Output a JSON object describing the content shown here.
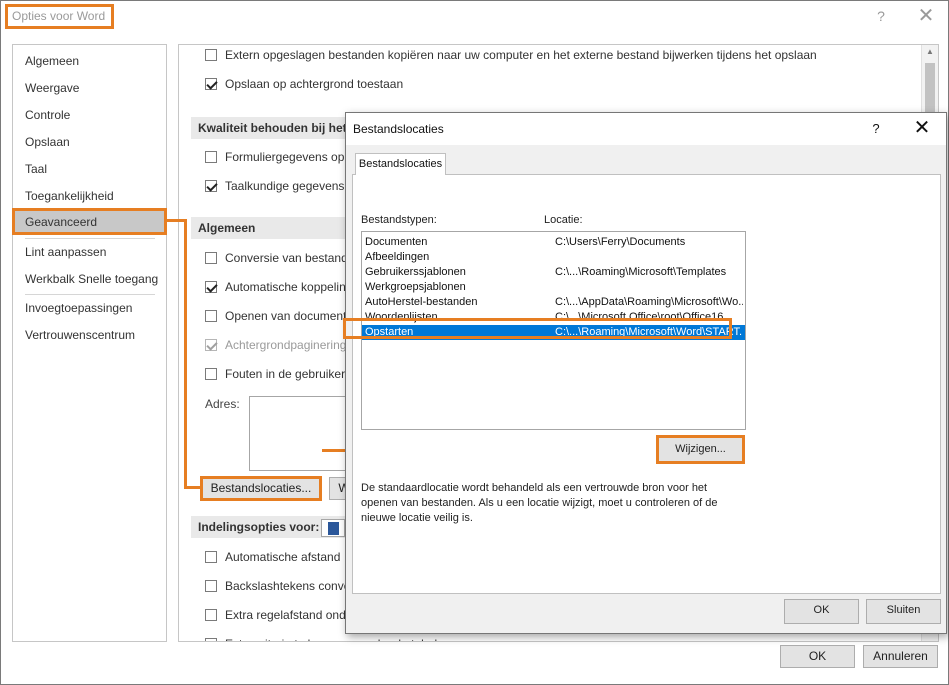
{
  "window": {
    "title": "Opties voor Word",
    "help": "?",
    "close": "✕"
  },
  "nav": {
    "items": [
      {
        "label": "Algemeen"
      },
      {
        "label": "Weergave"
      },
      {
        "label": "Controle"
      },
      {
        "label": "Opslaan"
      },
      {
        "label": "Taal"
      },
      {
        "label": "Toegankelijkheid"
      },
      {
        "label": "Geavanceerd",
        "selected": true
      },
      {
        "label": "Lint aanpassen"
      },
      {
        "label": "Werkbalk Snelle toegang"
      },
      {
        "label": "Invoegtoepassingen"
      },
      {
        "label": "Vertrouwenscentrum"
      }
    ]
  },
  "content": {
    "opt_extern": "Extern opgeslagen bestanden kopiëren naar uw computer en het externe bestand bijwerken tijdens het opslaan",
    "opt_achtergrond": "Opslaan op achtergrond toestaan",
    "section_kwaliteit": "Kwaliteit behouden bij het",
    "opt_formulier": "Formuliergegevens op",
    "opt_taalkundig": "Taalkundige gegevens",
    "section_algemeen": "Algemeen",
    "opt_conversie": "Conversie van bestand",
    "opt_koppeling": "Automatische koppelin",
    "opt_openen": "Openen van document",
    "opt_paginering": "Achtergrondpaginering",
    "opt_fouten": "Fouten in de gebruiker",
    "adres_label": "Adres:",
    "btn_bestandslocaties": "Bestandslocaties...",
    "btn_w": "W",
    "section_indeling": "Indelingsopties voor:",
    "opt_afstand": "Automatische afstand",
    "opt_backslash": "Backslashtekens conve",
    "opt_regelafstand": "Extra regelafstand ond",
    "opt_last": "Extra witruimte boven en onder de tabel"
  },
  "buttons": {
    "ok": "OK",
    "cancel": "Annuleren"
  },
  "dialog": {
    "title": "Bestandslocaties",
    "help": "?",
    "close": "✕",
    "tab": "Bestandslocaties",
    "hdr_types": "Bestandstypen:",
    "hdr_locatie": "Locatie:",
    "rows": [
      {
        "type": "Documenten",
        "path": "C:\\Users\\Ferry\\Documents"
      },
      {
        "type": "Afbeeldingen",
        "path": ""
      },
      {
        "type": "Gebruikerssjablonen",
        "path": "C:\\...\\Roaming\\Microsoft\\Templates"
      },
      {
        "type": "Werkgroepsjablonen",
        "path": ""
      },
      {
        "type": "AutoHerstel-bestanden",
        "path": "C:\\...\\AppData\\Roaming\\Microsoft\\Wo..."
      },
      {
        "type": "Woordenlijsten",
        "path": "C:\\...\\Microsoft Office\\root\\Office16"
      },
      {
        "type": "Opstarten",
        "path": "C:\\...\\Roaming\\Microsoft\\Word\\START...",
        "selected": true
      }
    ],
    "btn_wijzigen": "Wijzigen...",
    "info": "De standaardlocatie wordt behandeld als een vertrouwde bron voor het openen van bestanden. Als u een locatie wijzigt, moet u controleren of de nieuwe locatie veilig is.",
    "btn_ok": "OK",
    "btn_sluiten": "Sluiten"
  },
  "colors": {
    "highlight": "#e67e22",
    "selection": "#0078d7",
    "nav_selected": "#c8c8c8",
    "section_bg": "#e9e9e9"
  }
}
